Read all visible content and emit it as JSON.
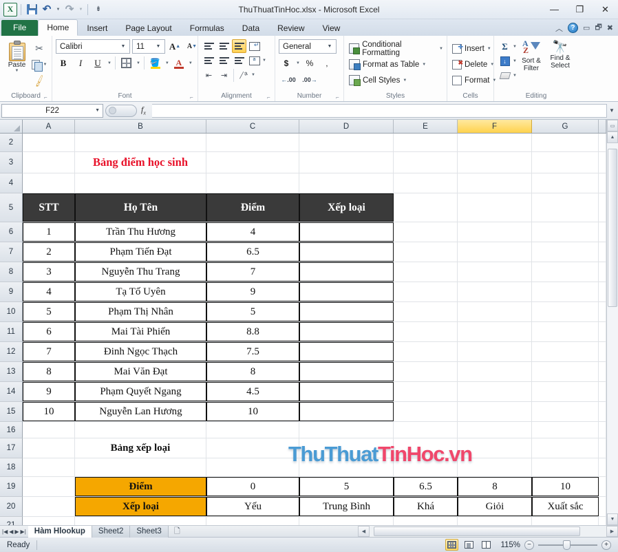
{
  "window": {
    "title": "ThuThuatTinHoc.xlsx  -  Microsoft Excel",
    "minimize": "—",
    "restore": "❐",
    "close": "✕"
  },
  "quick_access": {
    "save_tip": "Save",
    "undo_tip": "Undo",
    "redo_tip": "Redo",
    "customize_tip": "Customize Quick Access Toolbar"
  },
  "ribbon": {
    "tabs": [
      {
        "label": "File",
        "active": false,
        "file": true
      },
      {
        "label": "Home",
        "active": true
      },
      {
        "label": "Insert",
        "active": false
      },
      {
        "label": "Page Layout",
        "active": false
      },
      {
        "label": "Formulas",
        "active": false
      },
      {
        "label": "Data",
        "active": false
      },
      {
        "label": "Review",
        "active": false
      },
      {
        "label": "View",
        "active": false
      }
    ],
    "groups": {
      "clipboard": {
        "label": "Clipboard",
        "paste": "Paste",
        "cut_tip": "Cut",
        "copy_tip": "Copy",
        "format_painter_tip": "Format Painter"
      },
      "font": {
        "label": "Font",
        "font_name": "Calibri",
        "font_size": "11",
        "grow_font": "A",
        "shrink_font": "A",
        "bold": "B",
        "italic": "I",
        "underline": "U",
        "borders_tip": "Borders",
        "fill_color_tip": "Fill Color",
        "font_color": "A"
      },
      "alignment": {
        "label": "Alignment",
        "wrap_text_tip": "Wrap Text",
        "merge_tip": "Merge & Center",
        "orientation_tip": "Orientation",
        "indent_tip": "Indent"
      },
      "number": {
        "label": "Number",
        "format": "General",
        "currency": "$",
        "percent": "%",
        "comma": ",",
        "increase_decimal": ".00",
        "decrease_decimal": ".00"
      },
      "styles": {
        "label": "Styles",
        "items": [
          "Conditional Formatting",
          "Format as Table",
          "Cell Styles"
        ]
      },
      "cells": {
        "label": "Cells",
        "items": [
          "Insert",
          "Delete",
          "Format"
        ]
      },
      "editing": {
        "label": "Editing",
        "autosum": "Σ",
        "sort_filter": [
          "Sort &",
          "Filter"
        ],
        "find_select": [
          "Find &",
          "Select"
        ]
      }
    },
    "right_icons": {
      "minimize_ribbon": "⌃",
      "help": "?"
    }
  },
  "formula_bar": {
    "name_box": "F22",
    "fx_label": "fx",
    "value": ""
  },
  "grid": {
    "columns": [
      "A",
      "B",
      "C",
      "D",
      "E",
      "F",
      "G"
    ],
    "selected_column": "F",
    "rows": [
      "2",
      "3",
      "4",
      "5",
      "6",
      "7",
      "8",
      "9",
      "10",
      "11",
      "12",
      "13",
      "14",
      "15",
      "16",
      "17",
      "18",
      "19",
      "20",
      "21"
    ],
    "title_cell": "Bảng điểm học sinh",
    "table1_headers": [
      "STT",
      "Họ Tên",
      "Điểm",
      "Xếp loại"
    ],
    "table1_rows": [
      {
        "stt": "1",
        "name": "Trần Thu Hương",
        "score": "4",
        "grade": ""
      },
      {
        "stt": "2",
        "name": "Phạm Tiến Đạt",
        "score": "6.5",
        "grade": ""
      },
      {
        "stt": "3",
        "name": "Nguyễn Thu Trang",
        "score": "7",
        "grade": ""
      },
      {
        "stt": "4",
        "name": "Tạ Tố Uyên",
        "score": "9",
        "grade": ""
      },
      {
        "stt": "5",
        "name": "Phạm Thị Nhân",
        "score": "5",
        "grade": ""
      },
      {
        "stt": "6",
        "name": "Mai Tài Phiến",
        "score": "8.8",
        "grade": ""
      },
      {
        "stt": "7",
        "name": "Đinh Ngọc Thạch",
        "score": "7.5",
        "grade": ""
      },
      {
        "stt": "8",
        "name": "Mai Văn Đạt",
        "score": "8",
        "grade": ""
      },
      {
        "stt": "9",
        "name": "Phạm Quyết Ngang",
        "score": "4.5",
        "grade": ""
      },
      {
        "stt": "10",
        "name": "Nguyễn Lan Hương",
        "score": "10",
        "grade": ""
      }
    ],
    "table2_title": "Bảng xếp loại",
    "table2": {
      "row_labels": [
        "Điểm",
        "Xếp loại"
      ],
      "scores": [
        "0",
        "5",
        "6.5",
        "8",
        "10"
      ],
      "grades": [
        "Yếu",
        "Trung Bình",
        "Khá",
        "Giỏi",
        "Xuất sắc"
      ]
    },
    "watermark": {
      "part1": "ThuThuat",
      "part2": "TinHoc.vn",
      "color1": "#4a9bd4",
      "color2": "#f0476b"
    }
  },
  "sheet_tabs": {
    "tabs": [
      "Hàm Hlookup",
      "Sheet2",
      "Sheet3"
    ],
    "active": "Hàm Hlookup",
    "new_sheet_tip": "Insert Worksheet"
  },
  "status_bar": {
    "state": "Ready",
    "view_normal_tip": "Normal",
    "view_layout_tip": "Page Layout",
    "view_break_tip": "Page Break Preview",
    "zoom": "115%",
    "zoom_out": "−",
    "zoom_in": "+"
  }
}
